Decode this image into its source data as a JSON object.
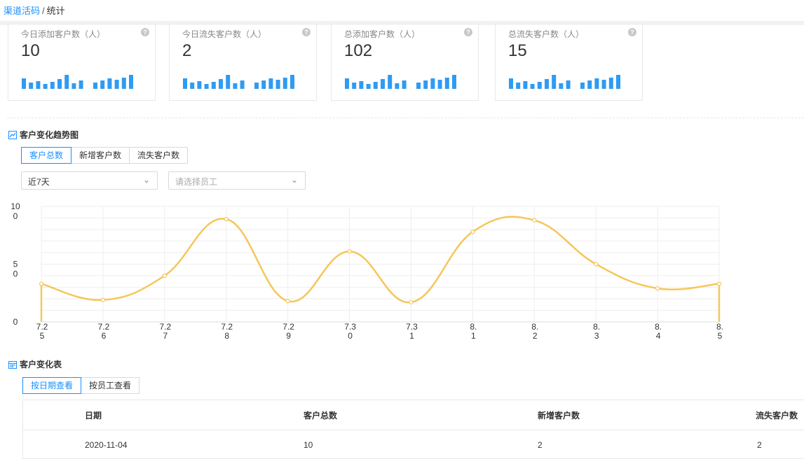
{
  "breadcrumb": {
    "parent": "渠道活码",
    "separator": "/",
    "current": "统计"
  },
  "cards": [
    {
      "label": "今日添加客户数（人）",
      "value": "10"
    },
    {
      "label": "今日流失客户数（人）",
      "value": "2"
    },
    {
      "label": "总添加客户数（人）",
      "value": "102"
    },
    {
      "label": "总流失客户数（人）",
      "value": "15"
    }
  ],
  "card_help_glyph": "?",
  "mini_bars": [
    0.75,
    0.45,
    0.55,
    0.35,
    0.5,
    0.7,
    1.0,
    0.4,
    0.6,
    0.0,
    0.45,
    0.6,
    0.75,
    0.65,
    0.8,
    1.0
  ],
  "colors": {
    "accent": "#1890ff",
    "bar": "#2f9bf2",
    "line": "#f5c65a",
    "grid": "#eeeeee"
  },
  "trend": {
    "title": "客户变化趋势图",
    "tabs": [
      "客户总数",
      "新增客户数",
      "流失客户数"
    ],
    "active_tab": 0,
    "range_select": "近7天",
    "staff_select_placeholder": "请选择员工"
  },
  "chart_data": {
    "type": "line",
    "y_tick_labels": [
      [
        "10",
        "0"
      ],
      [
        "5",
        "0"
      ],
      [
        "0"
      ]
    ],
    "y_ticks": [
      100,
      50,
      0
    ],
    "ylim": [
      0,
      100
    ],
    "x": [
      "7.25",
      "7.26",
      "7.27",
      "7.28",
      "7.29",
      "7.30",
      "7.31",
      "8.1",
      "8.2",
      "8.3",
      "8.4",
      "8.5"
    ],
    "x_tick_labels": [
      [
        "7.2",
        "5"
      ],
      [
        "7.2",
        "6"
      ],
      [
        "7.2",
        "7"
      ],
      [
        "7.2",
        "8"
      ],
      [
        "7.2",
        "9"
      ],
      [
        "7.3",
        "0"
      ],
      [
        "7.3",
        "1"
      ],
      [
        "8.",
        "1"
      ],
      [
        "8.",
        "2"
      ],
      [
        "8.",
        "3"
      ],
      [
        "8.",
        "4"
      ],
      [
        "8.",
        "5"
      ]
    ],
    "series": [
      {
        "values": [
          33,
          19,
          40,
          89,
          18,
          61,
          17,
          78,
          88,
          50,
          29,
          33
        ]
      }
    ]
  },
  "table_section": {
    "title": "客户变化表",
    "tabs": [
      "按日期查看",
      "按员工查看"
    ],
    "active_tab": 0,
    "columns": [
      "日期",
      "客户总数",
      "新增客户数",
      "流失客户数"
    ],
    "rows": [
      [
        "2020-11-04",
        "10",
        "2",
        "2"
      ]
    ]
  }
}
